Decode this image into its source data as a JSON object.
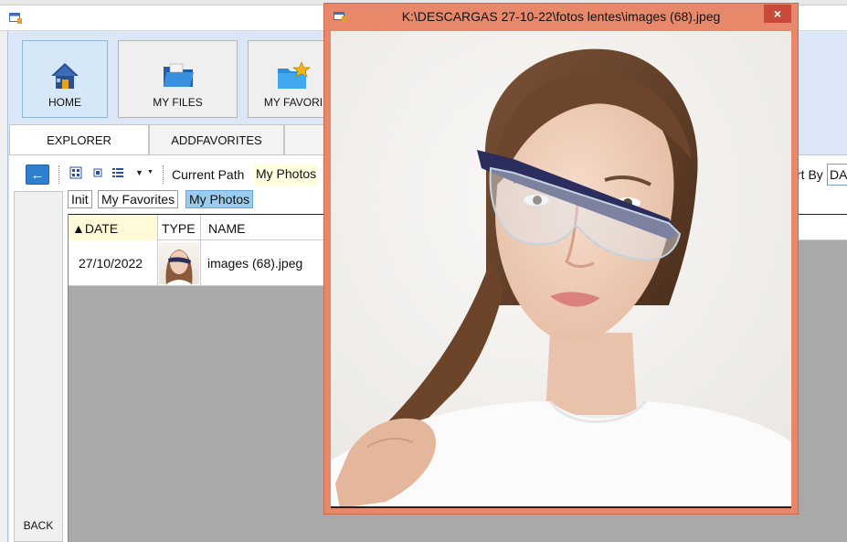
{
  "app": {
    "ribbon": [
      {
        "label": "HOME",
        "icon": "home-icon",
        "active": true
      },
      {
        "label": "MY FILES",
        "icon": "folder-icon",
        "active": false
      },
      {
        "label": "MY FAVORI",
        "icon": "favorite-folder-icon",
        "active": false
      }
    ],
    "tabs": [
      {
        "label": "EXPLORER",
        "active": true
      },
      {
        "label": "ADDFAVORITES",
        "active": false
      }
    ],
    "toolbar": {
      "current_path_label": "Current Path",
      "current_path_value": "My Photos",
      "sort_label": "rt By",
      "sort_value": "DA"
    },
    "breadcrumbs": [
      "Init",
      "My Favorites",
      "My Photos"
    ],
    "grid": {
      "columns": [
        "▲DATE",
        "TYPE",
        "NAME"
      ],
      "rows": [
        {
          "date": "27/10/2022",
          "type": "image-thumbnail",
          "name": "images (68).jpeg"
        }
      ]
    },
    "back_label": "BACK"
  },
  "viewer": {
    "title": "K:\\DESCARGAS 27-10-22\\fotos lentes\\images (68).jpeg",
    "close_glyph": "×"
  },
  "colors": {
    "ribbon_bg": "#dbe7f6",
    "viewer_frame": "#e8886a",
    "viewer_close": "#c9493a",
    "active_crumb": "#99ccee",
    "grid_empty": "#a9a9a9"
  }
}
